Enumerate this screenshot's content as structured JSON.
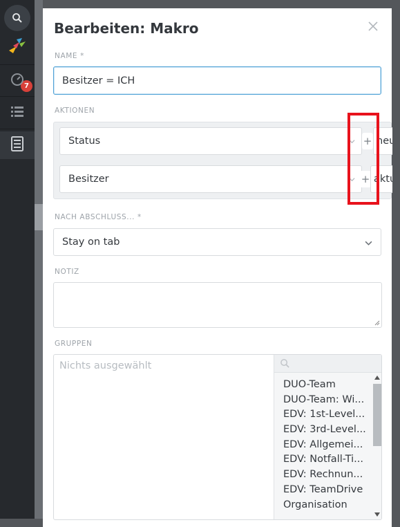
{
  "nav": {
    "items": [
      {
        "icon": "search-icon"
      },
      {
        "icon": "bird-logo-icon",
        "badge": "7"
      },
      {
        "icon": "dashboard-icon"
      },
      {
        "icon": "list-icon"
      },
      {
        "icon": "document-icon"
      }
    ]
  },
  "modal": {
    "title": "Bearbeiten: Makro",
    "name_label": "NAME *",
    "name_value": "Besitzer = ICH",
    "actions_label": "AKTIONEN",
    "actions": [
      {
        "attribute": "Status",
        "value": "neu"
      },
      {
        "attribute": "Besitzer",
        "value": "aktu"
      }
    ],
    "after_label": "NACH ABSCHLUSS... *",
    "after_value": "Stay on tab",
    "note_label": "NOTIZ",
    "groups_label": "GRUPPEN",
    "groups_placeholder": "Nichts ausgewählt",
    "groups_list": [
      "DUO-Team",
      "DUO-Team: Wi...",
      "EDV: 1st-Level...",
      "EDV: 3rd-Level...",
      "EDV: Allgemei...",
      "EDV: Notfall-Ti...",
      "EDV: Rechnun...",
      "EDV: TeamDrive",
      "Organisation"
    ]
  },
  "colors": {
    "highlight_box": "#e8121c",
    "focus_border": "#4fa1d5",
    "badge": "#d8413a"
  }
}
